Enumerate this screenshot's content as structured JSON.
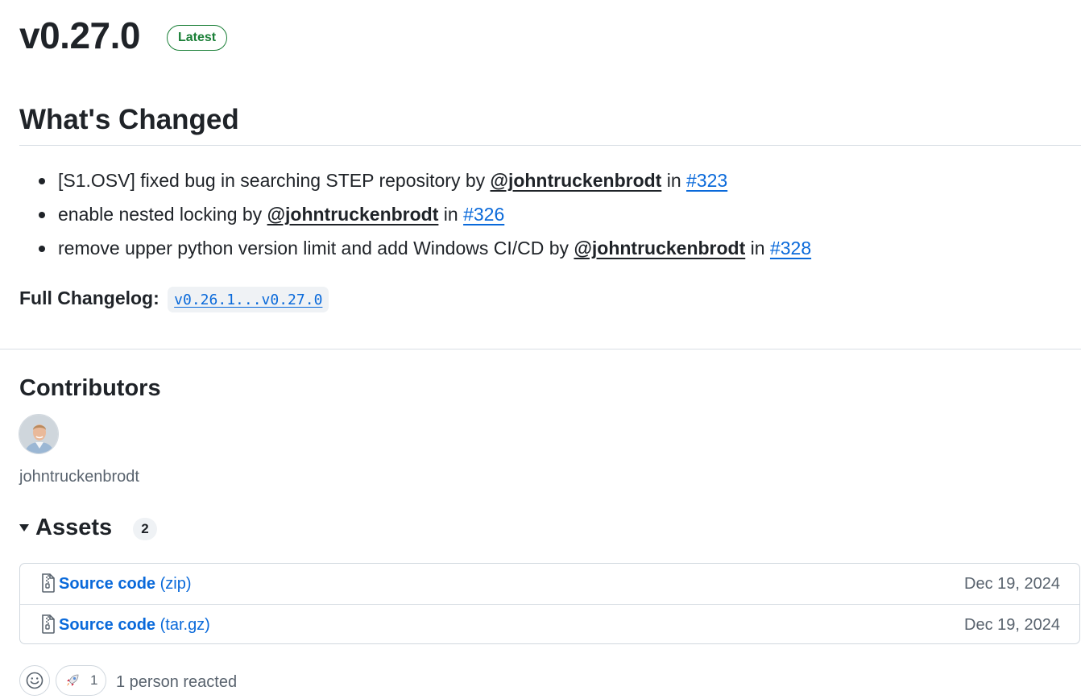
{
  "release": {
    "title": "v0.27.0",
    "badge": "Latest",
    "badge_color": "#1a7f37"
  },
  "changes": {
    "heading": "What's Changed",
    "items": [
      {
        "text": "[S1.OSV] fixed bug in searching STEP repository by ",
        "author": "@johntruckenbrodt",
        "in": " in ",
        "issue": "#323"
      },
      {
        "text": "enable nested locking by ",
        "author": "@johntruckenbrodt",
        "in": " in ",
        "issue": "#326"
      },
      {
        "text": "remove upper python version limit and add Windows CI/CD by ",
        "author": "@johntruckenbrodt",
        "in": " in ",
        "issue": "#328"
      }
    ],
    "full_changelog_label": "Full Changelog",
    "full_changelog_sep": ": ",
    "compare_link": "v0.26.1...v0.27.0"
  },
  "contributors": {
    "heading": "Contributors",
    "names": [
      "johntruckenbrodt"
    ]
  },
  "assets": {
    "heading": "Assets",
    "count": "2",
    "items": [
      {
        "name": "Source code",
        "type": "(zip)",
        "date": "Dec 19, 2024",
        "icon": "file-zip-icon"
      },
      {
        "name": "Source code",
        "type": "(tar.gz)",
        "date": "Dec 19, 2024",
        "icon": "file-zip-icon"
      }
    ]
  },
  "reactions": {
    "add_icon": "smiley-icon",
    "rocket_icon": "rocket-icon",
    "rocket_count": "1",
    "summary": "1 person reacted"
  },
  "colors": {
    "link": "#0969da",
    "text": "#1f2328",
    "muted": "#59636e",
    "border": "#d0d7de"
  }
}
